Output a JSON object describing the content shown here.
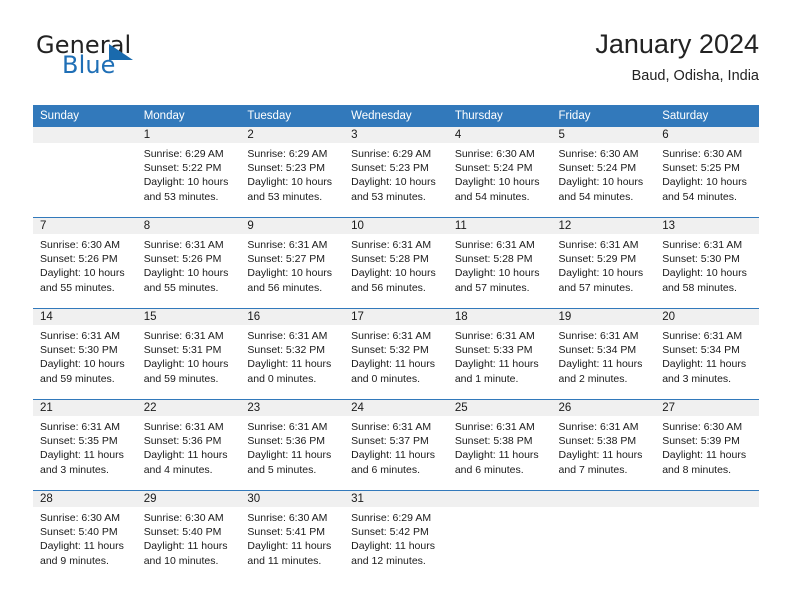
{
  "brand": {
    "word1": "General",
    "word2": "Blue",
    "flag_icon": "triangle-flag-icon"
  },
  "header": {
    "title": "January 2024",
    "subtitle": "Baud, Odisha, India"
  },
  "colors": {
    "header_blue": "#3279bb",
    "brand_blue": "#1f6fb6",
    "daynum_bg": "#f0f0f0",
    "text": "#1a1a1a"
  },
  "weekday_headers": [
    "Sunday",
    "Monday",
    "Tuesday",
    "Wednesday",
    "Thursday",
    "Friday",
    "Saturday"
  ],
  "weeks": [
    [
      {
        "day": "",
        "sunrise": "",
        "sunset": "",
        "daylight1": "",
        "daylight2": "",
        "blank": true
      },
      {
        "day": "1",
        "sunrise": "Sunrise: 6:29 AM",
        "sunset": "Sunset: 5:22 PM",
        "daylight1": "Daylight: 10 hours",
        "daylight2": "and 53 minutes."
      },
      {
        "day": "2",
        "sunrise": "Sunrise: 6:29 AM",
        "sunset": "Sunset: 5:23 PM",
        "daylight1": "Daylight: 10 hours",
        "daylight2": "and 53 minutes."
      },
      {
        "day": "3",
        "sunrise": "Sunrise: 6:29 AM",
        "sunset": "Sunset: 5:23 PM",
        "daylight1": "Daylight: 10 hours",
        "daylight2": "and 53 minutes."
      },
      {
        "day": "4",
        "sunrise": "Sunrise: 6:30 AM",
        "sunset": "Sunset: 5:24 PM",
        "daylight1": "Daylight: 10 hours",
        "daylight2": "and 54 minutes."
      },
      {
        "day": "5",
        "sunrise": "Sunrise: 6:30 AM",
        "sunset": "Sunset: 5:24 PM",
        "daylight1": "Daylight: 10 hours",
        "daylight2": "and 54 minutes."
      },
      {
        "day": "6",
        "sunrise": "Sunrise: 6:30 AM",
        "sunset": "Sunset: 5:25 PM",
        "daylight1": "Daylight: 10 hours",
        "daylight2": "and 54 minutes."
      }
    ],
    [
      {
        "day": "7",
        "sunrise": "Sunrise: 6:30 AM",
        "sunset": "Sunset: 5:26 PM",
        "daylight1": "Daylight: 10 hours",
        "daylight2": "and 55 minutes."
      },
      {
        "day": "8",
        "sunrise": "Sunrise: 6:31 AM",
        "sunset": "Sunset: 5:26 PM",
        "daylight1": "Daylight: 10 hours",
        "daylight2": "and 55 minutes."
      },
      {
        "day": "9",
        "sunrise": "Sunrise: 6:31 AM",
        "sunset": "Sunset: 5:27 PM",
        "daylight1": "Daylight: 10 hours",
        "daylight2": "and 56 minutes."
      },
      {
        "day": "10",
        "sunrise": "Sunrise: 6:31 AM",
        "sunset": "Sunset: 5:28 PM",
        "daylight1": "Daylight: 10 hours",
        "daylight2": "and 56 minutes."
      },
      {
        "day": "11",
        "sunrise": "Sunrise: 6:31 AM",
        "sunset": "Sunset: 5:28 PM",
        "daylight1": "Daylight: 10 hours",
        "daylight2": "and 57 minutes."
      },
      {
        "day": "12",
        "sunrise": "Sunrise: 6:31 AM",
        "sunset": "Sunset: 5:29 PM",
        "daylight1": "Daylight: 10 hours",
        "daylight2": "and 57 minutes."
      },
      {
        "day": "13",
        "sunrise": "Sunrise: 6:31 AM",
        "sunset": "Sunset: 5:30 PM",
        "daylight1": "Daylight: 10 hours",
        "daylight2": "and 58 minutes."
      }
    ],
    [
      {
        "day": "14",
        "sunrise": "Sunrise: 6:31 AM",
        "sunset": "Sunset: 5:30 PM",
        "daylight1": "Daylight: 10 hours",
        "daylight2": "and 59 minutes."
      },
      {
        "day": "15",
        "sunrise": "Sunrise: 6:31 AM",
        "sunset": "Sunset: 5:31 PM",
        "daylight1": "Daylight: 10 hours",
        "daylight2": "and 59 minutes."
      },
      {
        "day": "16",
        "sunrise": "Sunrise: 6:31 AM",
        "sunset": "Sunset: 5:32 PM",
        "daylight1": "Daylight: 11 hours",
        "daylight2": "and 0 minutes."
      },
      {
        "day": "17",
        "sunrise": "Sunrise: 6:31 AM",
        "sunset": "Sunset: 5:32 PM",
        "daylight1": "Daylight: 11 hours",
        "daylight2": "and 0 minutes."
      },
      {
        "day": "18",
        "sunrise": "Sunrise: 6:31 AM",
        "sunset": "Sunset: 5:33 PM",
        "daylight1": "Daylight: 11 hours",
        "daylight2": "and 1 minute."
      },
      {
        "day": "19",
        "sunrise": "Sunrise: 6:31 AM",
        "sunset": "Sunset: 5:34 PM",
        "daylight1": "Daylight: 11 hours",
        "daylight2": "and 2 minutes."
      },
      {
        "day": "20",
        "sunrise": "Sunrise: 6:31 AM",
        "sunset": "Sunset: 5:34 PM",
        "daylight1": "Daylight: 11 hours",
        "daylight2": "and 3 minutes."
      }
    ],
    [
      {
        "day": "21",
        "sunrise": "Sunrise: 6:31 AM",
        "sunset": "Sunset: 5:35 PM",
        "daylight1": "Daylight: 11 hours",
        "daylight2": "and 3 minutes."
      },
      {
        "day": "22",
        "sunrise": "Sunrise: 6:31 AM",
        "sunset": "Sunset: 5:36 PM",
        "daylight1": "Daylight: 11 hours",
        "daylight2": "and 4 minutes."
      },
      {
        "day": "23",
        "sunrise": "Sunrise: 6:31 AM",
        "sunset": "Sunset: 5:36 PM",
        "daylight1": "Daylight: 11 hours",
        "daylight2": "and 5 minutes."
      },
      {
        "day": "24",
        "sunrise": "Sunrise: 6:31 AM",
        "sunset": "Sunset: 5:37 PM",
        "daylight1": "Daylight: 11 hours",
        "daylight2": "and 6 minutes."
      },
      {
        "day": "25",
        "sunrise": "Sunrise: 6:31 AM",
        "sunset": "Sunset: 5:38 PM",
        "daylight1": "Daylight: 11 hours",
        "daylight2": "and 6 minutes."
      },
      {
        "day": "26",
        "sunrise": "Sunrise: 6:31 AM",
        "sunset": "Sunset: 5:38 PM",
        "daylight1": "Daylight: 11 hours",
        "daylight2": "and 7 minutes."
      },
      {
        "day": "27",
        "sunrise": "Sunrise: 6:30 AM",
        "sunset": "Sunset: 5:39 PM",
        "daylight1": "Daylight: 11 hours",
        "daylight2": "and 8 minutes."
      }
    ],
    [
      {
        "day": "28",
        "sunrise": "Sunrise: 6:30 AM",
        "sunset": "Sunset: 5:40 PM",
        "daylight1": "Daylight: 11 hours",
        "daylight2": "and 9 minutes."
      },
      {
        "day": "29",
        "sunrise": "Sunrise: 6:30 AM",
        "sunset": "Sunset: 5:40 PM",
        "daylight1": "Daylight: 11 hours",
        "daylight2": "and 10 minutes."
      },
      {
        "day": "30",
        "sunrise": "Sunrise: 6:30 AM",
        "sunset": "Sunset: 5:41 PM",
        "daylight1": "Daylight: 11 hours",
        "daylight2": "and 11 minutes."
      },
      {
        "day": "31",
        "sunrise": "Sunrise: 6:29 AM",
        "sunset": "Sunset: 5:42 PM",
        "daylight1": "Daylight: 11 hours",
        "daylight2": "and 12 minutes."
      },
      {
        "day": "",
        "sunrise": "",
        "sunset": "",
        "daylight1": "",
        "daylight2": "",
        "blank": true
      },
      {
        "day": "",
        "sunrise": "",
        "sunset": "",
        "daylight1": "",
        "daylight2": "",
        "blank": true
      },
      {
        "day": "",
        "sunrise": "",
        "sunset": "",
        "daylight1": "",
        "daylight2": "",
        "blank": true
      }
    ]
  ]
}
